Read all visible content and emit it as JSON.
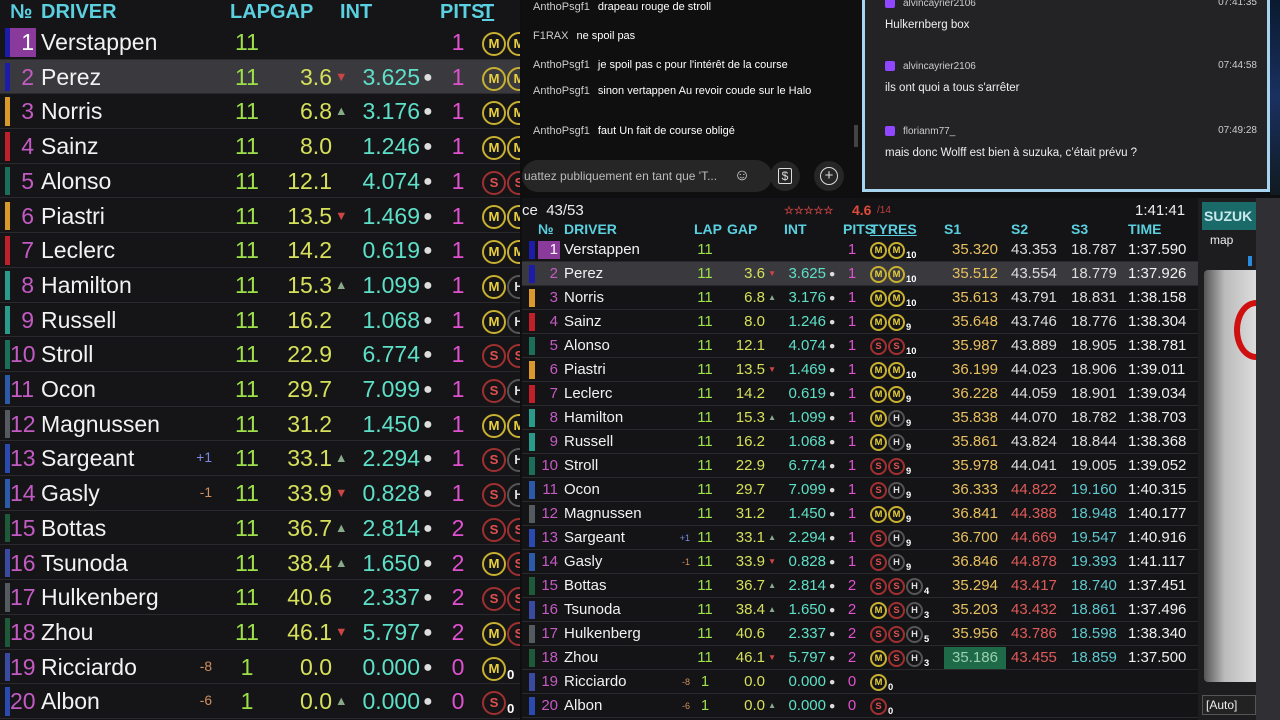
{
  "headers": {
    "pos": "№",
    "driver": "DRIVER",
    "lap": "LAP",
    "gap": "GAP",
    "int": "INT",
    "pits": "PITS",
    "tyres": "TYRES",
    "tyres_cut": "T",
    "s1": "S1",
    "s2": "S2",
    "s3": "S3",
    "time": "TIME"
  },
  "session": {
    "laps_label": "ce",
    "laps": "43/53",
    "stars": "☆☆☆☆☆",
    "rating": "4.6",
    "rating_count": "/14",
    "clock": "1:41:41"
  },
  "drivers": [
    {
      "pos": "1",
      "name": "Verstappen",
      "team": "#1c1ca8",
      "lap": "11",
      "gap": "",
      "trend": "",
      "int": "",
      "pits": "1",
      "tyres": [
        "M",
        "M"
      ],
      "age": "10",
      "delta": "",
      "s1": "35.320",
      "s2": "43.353",
      "s3": "18.787",
      "time": "1:37.590"
    },
    {
      "pos": "2",
      "name": "Perez",
      "team": "#1c1ca8",
      "lap": "11",
      "gap": "3.6",
      "trend": "dn",
      "int": "3.625",
      "pits": "1",
      "tyres": [
        "M",
        "M"
      ],
      "age": "10",
      "delta": "",
      "s1": "35.512",
      "s2": "43.554",
      "s3": "18.779",
      "time": "1:37.926"
    },
    {
      "pos": "3",
      "name": "Norris",
      "team": "#d99a2b",
      "lap": "11",
      "gap": "6.8",
      "trend": "up",
      "int": "3.176",
      "pits": "1",
      "tyres": [
        "M",
        "M"
      ],
      "age": "10",
      "delta": "",
      "s1": "35.613",
      "s2": "43.791",
      "s3": "18.831",
      "time": "1:38.158"
    },
    {
      "pos": "4",
      "name": "Sainz",
      "team": "#c0202a",
      "lap": "11",
      "gap": "8.0",
      "trend": "",
      "int": "1.246",
      "pits": "1",
      "tyres": [
        "M",
        "M"
      ],
      "age": "9",
      "delta": "",
      "s1": "35.648",
      "s2": "43.746",
      "s3": "18.776",
      "time": "1:38.304"
    },
    {
      "pos": "5",
      "name": "Alonso",
      "team": "#1a6e5a",
      "lap": "11",
      "gap": "12.1",
      "trend": "",
      "int": "4.074",
      "pits": "1",
      "tyres": [
        "S",
        "S"
      ],
      "age": "10",
      "delta": "",
      "s1": "35.987",
      "s2": "43.889",
      "s3": "18.905",
      "time": "1:38.781"
    },
    {
      "pos": "6",
      "name": "Piastri",
      "team": "#d99a2b",
      "lap": "11",
      "gap": "13.5",
      "trend": "dn",
      "int": "1.469",
      "pits": "1",
      "tyres": [
        "M",
        "M"
      ],
      "age": "10",
      "delta": "",
      "s1": "36.199",
      "s2": "44.023",
      "s3": "18.906",
      "time": "1:39.011"
    },
    {
      "pos": "7",
      "name": "Leclerc",
      "team": "#c0202a",
      "lap": "11",
      "gap": "14.2",
      "trend": "",
      "int": "0.619",
      "pits": "1",
      "tyres": [
        "M",
        "M"
      ],
      "age": "9",
      "delta": "",
      "s1": "36.228",
      "s2": "44.059",
      "s3": "18.901",
      "time": "1:39.034"
    },
    {
      "pos": "8",
      "name": "Hamilton",
      "team": "#2a9a8a",
      "lap": "11",
      "gap": "15.3",
      "trend": "up",
      "int": "1.099",
      "pits": "1",
      "tyres": [
        "M",
        "H"
      ],
      "age": "9",
      "delta": "",
      "s1": "35.838",
      "s2": "44.070",
      "s3": "18.782",
      "time": "1:38.703"
    },
    {
      "pos": "9",
      "name": "Russell",
      "team": "#2a9a8a",
      "lap": "11",
      "gap": "16.2",
      "trend": "",
      "int": "1.068",
      "pits": "1",
      "tyres": [
        "M",
        "H"
      ],
      "age": "9",
      "delta": "",
      "s1": "35.861",
      "s2": "43.824",
      "s3": "18.844",
      "time": "1:38.368"
    },
    {
      "pos": "10",
      "name": "Stroll",
      "team": "#1a6e5a",
      "lap": "11",
      "gap": "22.9",
      "trend": "",
      "int": "6.774",
      "pits": "1",
      "tyres": [
        "S",
        "S"
      ],
      "age": "9",
      "delta": "",
      "s1": "35.978",
      "s2": "44.041",
      "s3": "19.005",
      "time": "1:39.052"
    },
    {
      "pos": "11",
      "name": "Ocon",
      "team": "#2a5aa8",
      "lap": "11",
      "gap": "29.7",
      "trend": "",
      "int": "7.099",
      "pits": "1",
      "tyres": [
        "S",
        "H"
      ],
      "age": "9",
      "delta": "",
      "s1": "36.333",
      "s2": "44.822",
      "s3": "19.160",
      "time": "1:40.315",
      "slow": true
    },
    {
      "pos": "12",
      "name": "Magnussen",
      "team": "#555a60",
      "lap": "11",
      "gap": "31.2",
      "trend": "",
      "int": "1.450",
      "pits": "1",
      "tyres": [
        "M",
        "M"
      ],
      "age": "9",
      "delta": "",
      "s1": "36.841",
      "s2": "44.388",
      "s3": "18.948",
      "time": "1:40.177",
      "slow": true
    },
    {
      "pos": "13",
      "name": "Sargeant",
      "team": "#2a4ab0",
      "lap": "11",
      "gap": "33.1",
      "trend": "up",
      "int": "2.294",
      "pits": "1",
      "tyres": [
        "S",
        "H"
      ],
      "age": "9",
      "delta": "+1",
      "s1": "36.700",
      "s2": "44.669",
      "s3": "19.547",
      "time": "1:40.916",
      "slow": true
    },
    {
      "pos": "14",
      "name": "Gasly",
      "team": "#2a5aa8",
      "lap": "11",
      "gap": "33.9",
      "trend": "dn",
      "int": "0.828",
      "pits": "1",
      "tyres": [
        "S",
        "H"
      ],
      "age": "9",
      "delta": "-1",
      "s1": "36.846",
      "s2": "44.878",
      "s3": "19.393",
      "time": "1:41.117",
      "slow": true
    },
    {
      "pos": "15",
      "name": "Bottas",
      "team": "#1e5a3a",
      "lap": "11",
      "gap": "36.7",
      "trend": "up",
      "int": "2.814",
      "pits": "2",
      "tyres": [
        "S",
        "S",
        "H"
      ],
      "age": "4",
      "delta": "",
      "s1": "35.294",
      "s2": "43.417",
      "s3": "18.740",
      "time": "1:37.451",
      "slow": true
    },
    {
      "pos": "16",
      "name": "Tsunoda",
      "team": "#3a4aa0",
      "lap": "11",
      "gap": "38.4",
      "trend": "up",
      "int": "1.650",
      "pits": "2",
      "tyres": [
        "M",
        "S",
        "H"
      ],
      "age": "3",
      "delta": "",
      "s1": "35.203",
      "s2": "43.432",
      "s3": "18.861",
      "time": "1:37.496",
      "slow": true
    },
    {
      "pos": "17",
      "name": "Hulkenberg",
      "team": "#555a60",
      "lap": "11",
      "gap": "40.6",
      "trend": "",
      "int": "2.337",
      "pits": "2",
      "tyres": [
        "S",
        "S",
        "H"
      ],
      "age": "5",
      "delta": "",
      "s1": "35.956",
      "s2": "43.786",
      "s3": "18.598",
      "time": "1:38.340",
      "slow": true
    },
    {
      "pos": "18",
      "name": "Zhou",
      "team": "#1e5a3a",
      "lap": "11",
      "gap": "46.1",
      "trend": "dn",
      "int": "5.797",
      "pits": "2",
      "tyres": [
        "M",
        "S",
        "H"
      ],
      "age": "3",
      "delta": "",
      "s1": "35.186",
      "s2": "43.455",
      "s3": "18.859",
      "time": "1:37.500",
      "slow": true,
      "best": true
    },
    {
      "pos": "19",
      "name": "Ricciardo",
      "team": "#3a4aa0",
      "lap": "1",
      "gap": "0.0",
      "trend": "",
      "int": "0.000",
      "pits": "0",
      "tyres": [
        "M"
      ],
      "age": "0",
      "delta": "-8",
      "s1": "",
      "s2": "",
      "s3": "",
      "time": ""
    },
    {
      "pos": "20",
      "name": "Albon",
      "team": "#2a4ab0",
      "lap": "1",
      "gap": "0.0",
      "trend": "up",
      "int": "0.000",
      "pits": "0",
      "tyres": [
        "S"
      ],
      "age": "0",
      "delta": "-6",
      "s1": "",
      "s2": "",
      "s3": "",
      "time": ""
    }
  ],
  "youtube_chat": {
    "messages": [
      {
        "user": "AnthoPsgf1",
        "text": "drapeau rouge de stroll"
      },
      {
        "user": "F1RAX",
        "text": "ne spoil pas"
      },
      {
        "user": "AnthoPsgf1",
        "text": "je spoil pas c pour l'intérêt de la course"
      },
      {
        "user": "AnthoPsgf1",
        "text": "sinon vertappen Au revoir coude sur le Halo"
      },
      {
        "user": "AnthoPsgf1",
        "text": "faut Un fait de course obligé"
      }
    ],
    "input_placeholder": "uattez publiquement en tant que 'T...",
    "icons": [
      "emoji-icon",
      "super-chat-icon",
      "add-icon"
    ]
  },
  "twitch_chat": {
    "messages": [
      {
        "user": "alvincayrier2106",
        "time": "07:41:35",
        "text": "Hulkernberg box"
      },
      {
        "user": "alvincayrier2106",
        "time": "07:44:58",
        "text": "ils ont quoi a tous s'arrêter"
      },
      {
        "user": "florianm77_",
        "time": "07:49:28",
        "text": "mais donc Wolff est bien à suzuka, c’était prévu ?"
      }
    ]
  },
  "side": {
    "track": "SUZUK",
    "map_label": "map",
    "mode": "[Auto]"
  },
  "colors": {
    "header": "#5ad0e0",
    "track_red": "#d01010"
  }
}
